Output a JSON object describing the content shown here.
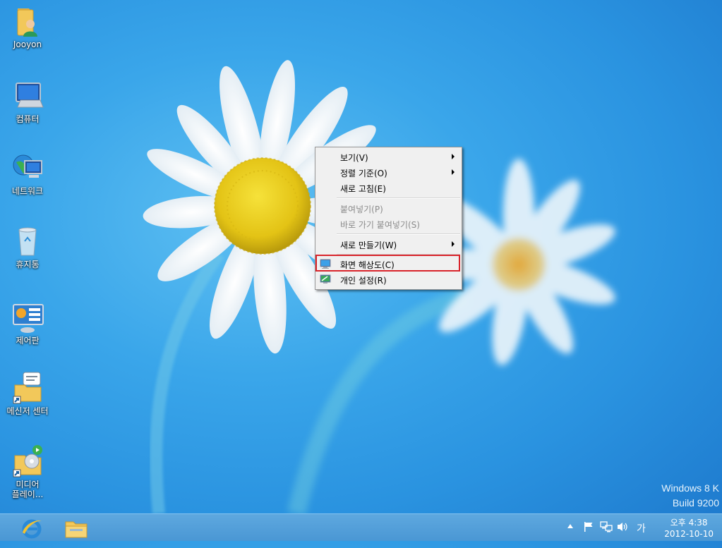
{
  "desktop": {
    "icons": [
      {
        "label": "Jooyon",
        "icon": "user-folder-icon"
      },
      {
        "label": "컴퓨터",
        "icon": "computer-icon"
      },
      {
        "label": "네트워크",
        "icon": "network-icon"
      },
      {
        "label": "휴지통",
        "icon": "recycle-bin-icon"
      },
      {
        "label": "제어판",
        "icon": "control-panel-icon"
      },
      {
        "label": "메신저 센터",
        "icon": "messenger-center-icon"
      },
      {
        "label": "미디어\n플레이...",
        "line1": "미디어",
        "line2": "플레이..."
      }
    ],
    "watermark": {
      "line1": "Windows 8 K",
      "line2": "Build 9200"
    }
  },
  "context_menu": {
    "items": [
      {
        "label": "보기(V)",
        "submenu": true
      },
      {
        "label": "정렬 기준(O)",
        "submenu": true
      },
      {
        "label": "새로 고침(E)"
      },
      {
        "label": "붙여넣기(P)",
        "disabled": true
      },
      {
        "label": "바로 가기 붙여넣기(S)",
        "disabled": true
      },
      {
        "label": "새로 만들기(W)",
        "submenu": true
      },
      {
        "label": "화면 해상도(C)",
        "highlighted": true,
        "icon": "screen-resolution-icon"
      },
      {
        "label": "개인 설정(R)",
        "icon": "personalize-icon"
      }
    ],
    "highlight_color": "#d9232a"
  },
  "taskbar": {
    "pinned": [
      "internet-explorer-icon",
      "file-explorer-icon"
    ],
    "tray": {
      "ime": "가",
      "time": "오후 4:38",
      "date": "2012-10-10"
    },
    "color": "#4f9cd8"
  }
}
